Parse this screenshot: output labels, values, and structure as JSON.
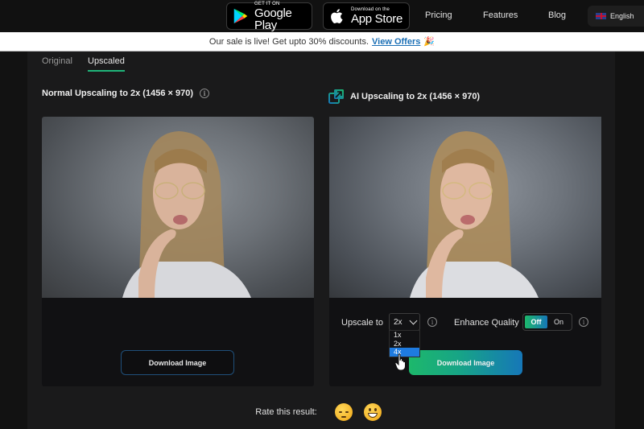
{
  "nav": {
    "google_play": {
      "small": "GET IT ON",
      "big": "Google Play"
    },
    "app_store": {
      "small": "Download on the",
      "big": "App Store"
    },
    "links": [
      "Pricing",
      "Features",
      "Blog"
    ],
    "language": "English"
  },
  "promo": {
    "text": "Our sale is live! Get upto 30% discounts.",
    "link": "View Offers",
    "emoji": "🎉"
  },
  "tabs": [
    {
      "label": "Original",
      "active": false
    },
    {
      "label": "Upscaled",
      "active": true
    }
  ],
  "left_panel": {
    "title": "Normal Upscaling to 2x (1456 × 970)",
    "download_label": "Download Image"
  },
  "right_panel": {
    "title": "AI Upscaling to 2x (1456 × 970)",
    "upscale_label": "Upscale to",
    "upscale_value": "2x",
    "upscale_options": [
      "1x",
      "2x",
      "4x"
    ],
    "upscale_highlighted": "4x",
    "enhance_label": "Enhance Quality",
    "toggle_off": "Off",
    "toggle_on": "On",
    "toggle_state": "Off",
    "download_label": "Download Image"
  },
  "rating": {
    "label": "Rate this result:",
    "options": [
      "sad-face",
      "happy-face"
    ]
  },
  "colors": {
    "accent_green": "#1fb47a",
    "accent_blue": "#1677b8",
    "link_blue": "#1b6fb5",
    "dropdown_highlight": "#1e7be0"
  }
}
